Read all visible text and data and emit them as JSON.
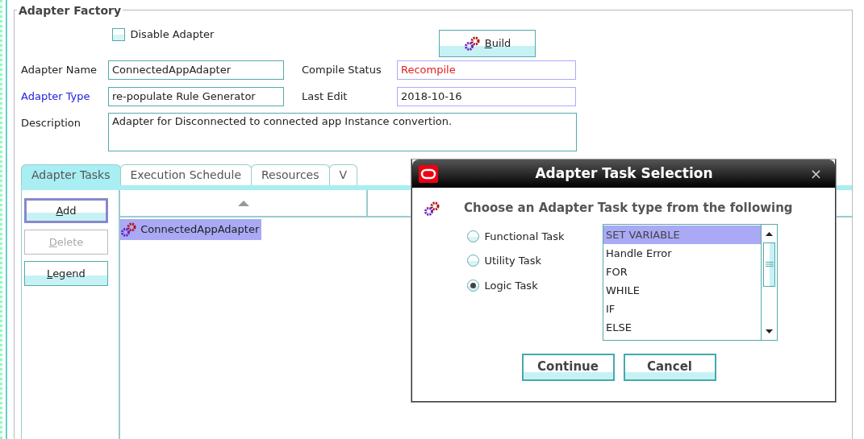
{
  "panel": {
    "title": "Adapter Factory"
  },
  "disable_adapter": {
    "label": "Disable Adapter",
    "checked": false
  },
  "build_button": {
    "label": "Build"
  },
  "fields": [
    {
      "label": "Adapter Name",
      "value": "ConnectedAppAdapter",
      "kind": "plain"
    },
    {
      "label": "Compile Status",
      "value": "Recompile",
      "kind": "status"
    },
    {
      "label": "Adapter Type",
      "value": "re-populate Rule Generator",
      "kind": "link"
    },
    {
      "label": "Last Edit",
      "value": "2018-10-16",
      "kind": "plain"
    }
  ],
  "description": {
    "label": "Description",
    "value": "Adapter for Disconnected to connected app Instance convertion."
  },
  "tabs": [
    {
      "label": "Adapter Tasks",
      "selected": true
    },
    {
      "label": "Execution Schedule",
      "selected": false
    },
    {
      "label": "Resources",
      "selected": false
    },
    {
      "label": "V",
      "selected": false
    }
  ],
  "task_buttons": [
    {
      "label": "Add",
      "disabled": false
    },
    {
      "label": "Delete",
      "disabled": true
    },
    {
      "label": "Legend",
      "disabled": false
    }
  ],
  "task_table": {
    "rows": [
      {
        "name": "ConnectedAppAdapter",
        "selected": true
      }
    ]
  },
  "dialog": {
    "title": "Adapter Task Selection",
    "close": "×",
    "prompt": "Choose an Adapter Task type from the following",
    "options": [
      {
        "label": "Functional Task",
        "selected": false
      },
      {
        "label": "Utility Task",
        "selected": false
      },
      {
        "label": "Logic Task",
        "selected": true
      }
    ],
    "task_types": [
      {
        "label": "SET VARIABLE",
        "selected": true
      },
      {
        "label": "Handle Error",
        "selected": false
      },
      {
        "label": "FOR",
        "selected": false
      },
      {
        "label": "WHILE",
        "selected": false
      },
      {
        "label": "IF",
        "selected": false
      },
      {
        "label": "ELSE",
        "selected": false
      }
    ],
    "buttons": [
      {
        "label": "Continue"
      },
      {
        "label": "Cancel"
      }
    ]
  }
}
